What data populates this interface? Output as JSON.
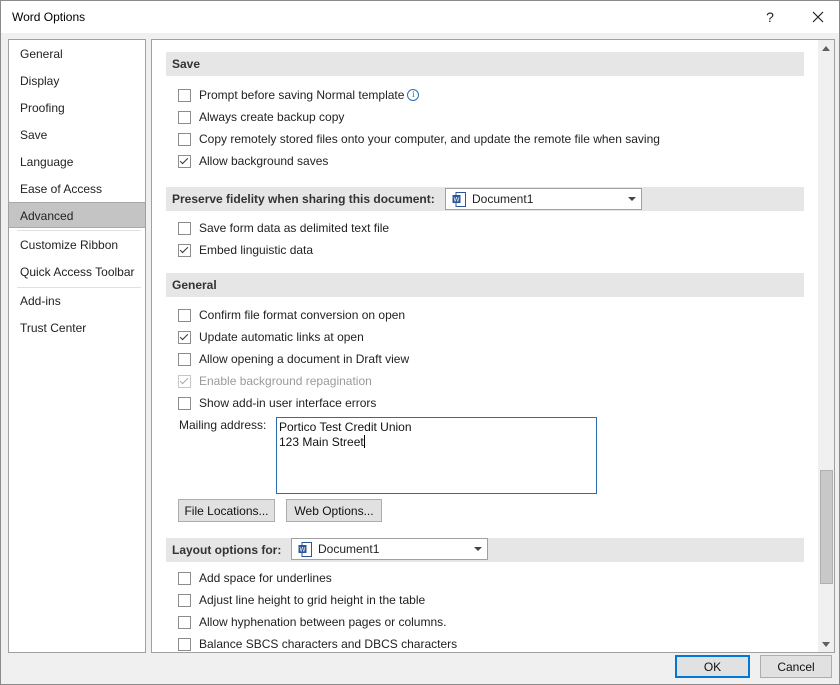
{
  "window": {
    "title": "Word Options",
    "help_glyph": "?",
    "close_glyph": "✕"
  },
  "sidebar": {
    "items": [
      {
        "label": "General"
      },
      {
        "label": "Display"
      },
      {
        "label": "Proofing"
      },
      {
        "label": "Save"
      },
      {
        "label": "Language"
      },
      {
        "label": "Ease of Access"
      },
      {
        "label": "Advanced",
        "selected": true
      },
      {
        "label": "Customize Ribbon"
      },
      {
        "label": "Quick Access Toolbar"
      },
      {
        "label": "Add-ins"
      },
      {
        "label": "Trust Center"
      }
    ]
  },
  "save_section": {
    "header": "Save",
    "options": [
      {
        "label": "Prompt before saving Normal template",
        "checked": false
      },
      {
        "label": "Always create backup copy",
        "checked": false
      },
      {
        "label": "Copy remotely stored files onto your computer, and update the remote file when saving",
        "checked": false
      },
      {
        "label": "Allow background saves",
        "checked": true
      }
    ]
  },
  "fidelity_section": {
    "header": "Preserve fidelity when sharing this document:",
    "document": "Document1",
    "options": [
      {
        "label": "Save form data as delimited text file",
        "checked": false
      },
      {
        "label": "Embed linguistic data",
        "checked": true
      }
    ]
  },
  "general_section": {
    "header": "General",
    "options": [
      {
        "label": "Confirm file format conversion on open",
        "checked": false
      },
      {
        "label": "Update automatic links at open",
        "checked": true
      },
      {
        "label": "Allow opening a document in Draft view",
        "checked": false
      },
      {
        "label": "Enable background repagination",
        "checked": true,
        "disabled": true
      },
      {
        "label": "Show add-in user interface errors",
        "checked": false
      }
    ],
    "mailing_label": "Mailing address:",
    "mailing_value": "Portico Test Credit Union\n123 Main Street",
    "file_locations_button": "File Locations...",
    "web_options_button": "Web Options..."
  },
  "layout_section": {
    "header": "Layout options for:",
    "document": "Document1",
    "options": [
      {
        "label": "Add space for underlines",
        "checked": false
      },
      {
        "label": "Adjust line height to grid height in the table",
        "checked": false
      },
      {
        "label": "Allow hyphenation between pages or columns.",
        "checked": false
      },
      {
        "label": "Balance SBCS characters and DBCS characters",
        "checked": false
      }
    ]
  },
  "footer": {
    "ok_label": "OK",
    "cancel_label": "Cancel"
  },
  "colors": {
    "accent": "#0078d7",
    "section_bg": "#e6e6e6",
    "selected_nav": "#c4c4c4"
  }
}
